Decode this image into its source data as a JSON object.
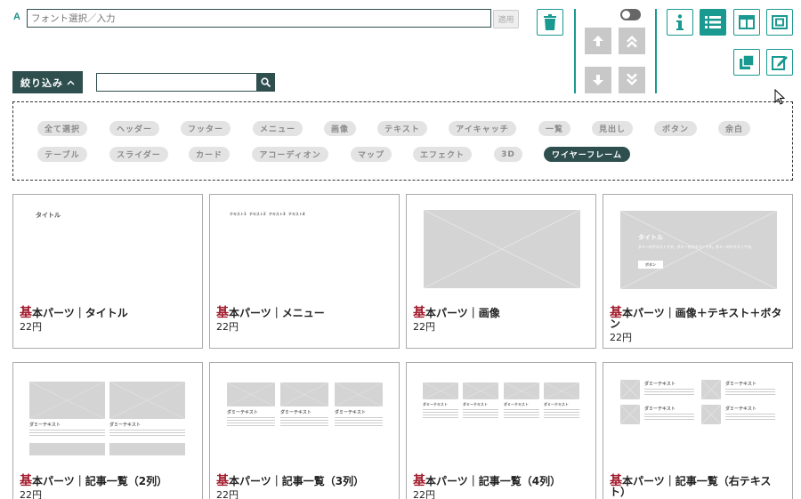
{
  "toolbar": {
    "font_icon_label": "A",
    "font_placeholder": "フォント選択／入力",
    "apply_label": "適用",
    "toggle_state": "off"
  },
  "filter": {
    "button_label": "絞り込み",
    "search_value": ""
  },
  "tags": [
    {
      "label": "全て選択",
      "active": false
    },
    {
      "label": "ヘッダー",
      "active": false
    },
    {
      "label": "フッター",
      "active": false
    },
    {
      "label": "メニュー",
      "active": false
    },
    {
      "label": "画像",
      "active": false
    },
    {
      "label": "テキスト",
      "active": false
    },
    {
      "label": "アイキャッチ",
      "active": false
    },
    {
      "label": "一覧",
      "active": false
    },
    {
      "label": "見出し",
      "active": false
    },
    {
      "label": "ボタン",
      "active": false
    },
    {
      "label": "余白",
      "active": false
    },
    {
      "label": "テーブル",
      "active": false
    },
    {
      "label": "スライダー",
      "active": false
    },
    {
      "label": "カード",
      "active": false
    },
    {
      "label": "アコーディオン",
      "active": false
    },
    {
      "label": "マップ",
      "active": false
    },
    {
      "label": "エフェクト",
      "active": false
    },
    {
      "label": "3D",
      "active": false
    },
    {
      "label": "ワイヤーフレーム",
      "active": true
    }
  ],
  "cards": [
    {
      "kanji": "基",
      "title": "本パーツ｜タイトル",
      "price": "22円",
      "preview": {
        "heading": "タイトル"
      }
    },
    {
      "kanji": "基",
      "title": "本パーツ｜メニュー",
      "price": "22円",
      "preview": {
        "menu": [
          "テキスト1",
          "テキスト2",
          "テキスト3",
          "テキスト4"
        ]
      }
    },
    {
      "kanji": "基",
      "title": "本パーツ｜画像",
      "price": "22円",
      "preview": {}
    },
    {
      "kanji": "基",
      "title": "本パーツ｜画像＋テキスト＋ボタン",
      "price": "22円",
      "preview": {
        "heading": "タイトル",
        "body": "ダミーのテキストです。ダミーのテキストです。ダミーのテキストです。",
        "button": "ボタン"
      }
    },
    {
      "kanji": "基",
      "title": "本パーツ｜記事一覧（2列）",
      "price": "22円",
      "preview": {
        "item_title": "ダミーテキスト"
      }
    },
    {
      "kanji": "基",
      "title": "本パーツ｜記事一覧（3列）",
      "price": "22円",
      "preview": {
        "item_title": "ダミーテキスト"
      }
    },
    {
      "kanji": "基",
      "title": "本パーツ｜記事一覧（4列）",
      "price": "22円",
      "preview": {
        "item_title": "ダミーテキスト"
      }
    },
    {
      "kanji": "基",
      "title": "本パーツ｜記事一覧（右テキスト）",
      "price": "",
      "preview": {
        "item_title": "ダミーテキスト"
      }
    }
  ],
  "colors": {
    "accent": "#1a9990",
    "dark": "#2f4f4f",
    "kanji": "#a0192a"
  }
}
